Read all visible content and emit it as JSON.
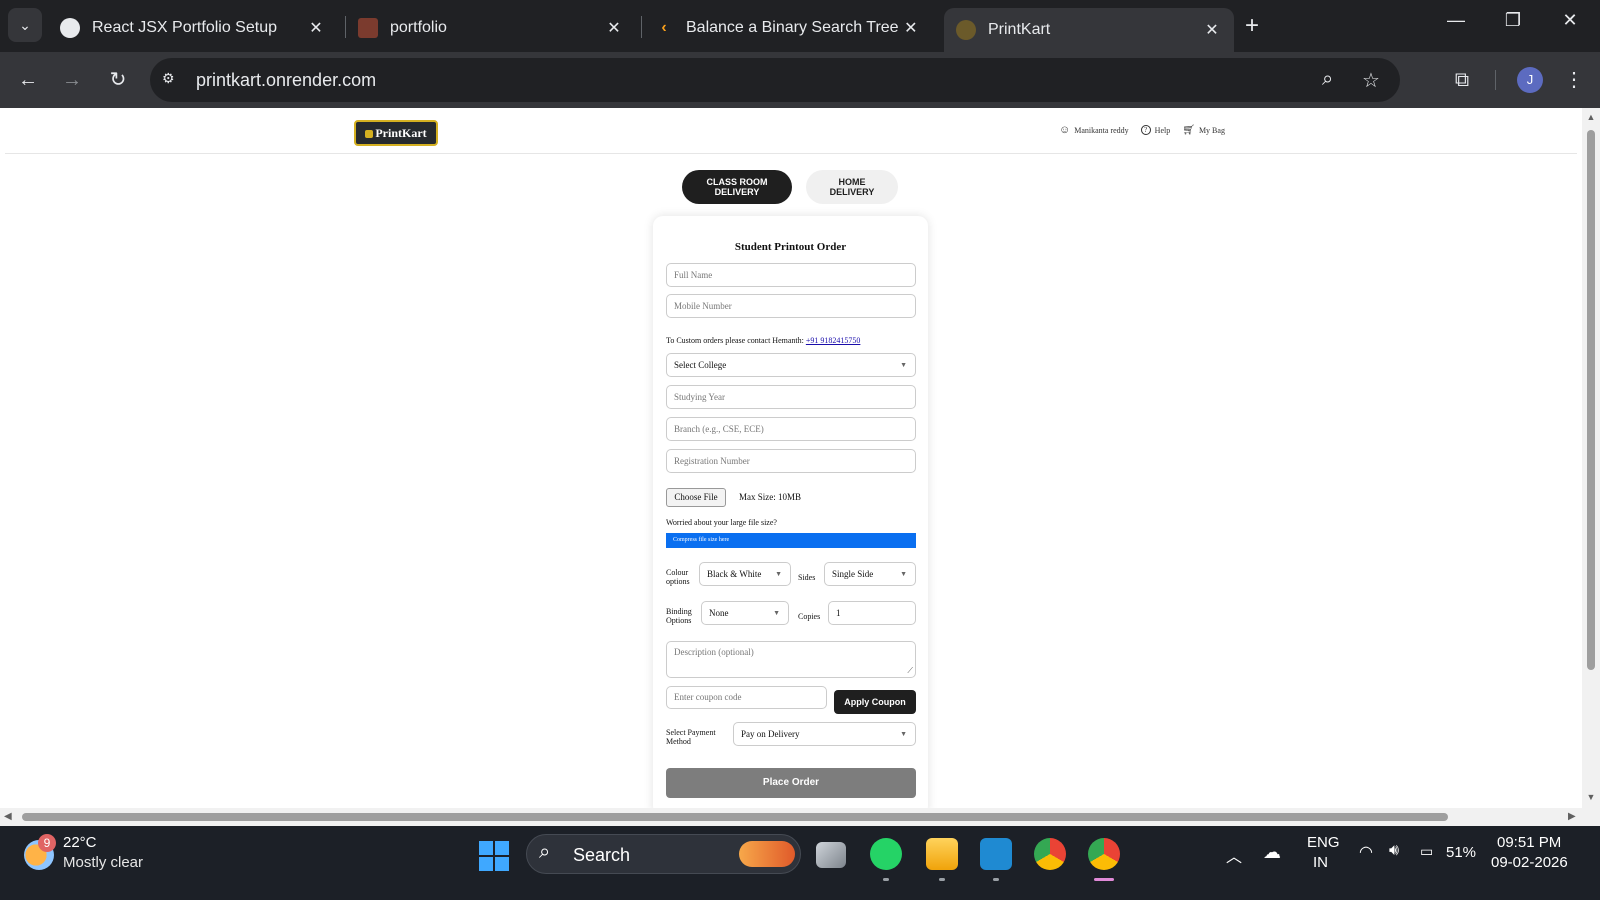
{
  "browser": {
    "tabs": [
      {
        "title": "React JSX Portfolio Setup",
        "favicon": "chatgpt-icon"
      },
      {
        "title": "portfolio",
        "favicon": "photo-icon"
      },
      {
        "title": "Balance a Binary Search Tree - L",
        "favicon": "leetcode-icon"
      },
      {
        "title": "PrintKart",
        "favicon": "printkart-icon",
        "active": true
      }
    ],
    "url": "printkart.onrender.com",
    "profile_initial": "J"
  },
  "site": {
    "logo": "PrintKart",
    "header_links": {
      "user": "Manikanta reddy",
      "help": "Help",
      "bag": "My Bag"
    },
    "delivery": {
      "classroom": "CLASS ROOM DELIVERY",
      "home": "HOME DELIVERY"
    },
    "form": {
      "title": "Student Printout Order",
      "full_name_placeholder": "Full Name",
      "mobile_placeholder": "Mobile Number",
      "contact_text": "To Custom orders please contact Hemanth:",
      "contact_phone": "+91 9182415750",
      "college_select": "Select College",
      "year_placeholder": "Studying Year",
      "branch_placeholder": "Branch (e.g., CSE, ECE)",
      "reg_placeholder": "Registration Number",
      "choose_file": "Choose File",
      "max_size": "Max Size: 10MB",
      "large_file_text": "Worried about your large file size?",
      "compress_link": "Compress file size here",
      "colour_label": "Colour options",
      "colour_value": "Black & White",
      "sides_label": "Sides",
      "sides_value": "Single Side",
      "binding_label": "Binding Options",
      "binding_value": "None",
      "copies_label": "Copies",
      "copies_value": "1",
      "description_placeholder": "Description (optional)",
      "coupon_placeholder": "Enter coupon code",
      "apply_coupon": "Apply Coupon",
      "payment_label": "Select Payment Method",
      "payment_value": "Pay on Delivery",
      "place_order": "Place Order"
    }
  },
  "taskbar": {
    "weather_badge": "9",
    "temperature": "22°C",
    "weather_desc": "Mostly clear",
    "search_label": "Search",
    "lang_top": "ENG",
    "lang_bottom": "IN",
    "battery": "51%",
    "time": "09:51 PM",
    "date": "09-02-2026"
  },
  "colors": {
    "accent_blue": "#0a6ff0",
    "logo_gold": "#d4b021",
    "dark_button": "#1f1f1f"
  }
}
